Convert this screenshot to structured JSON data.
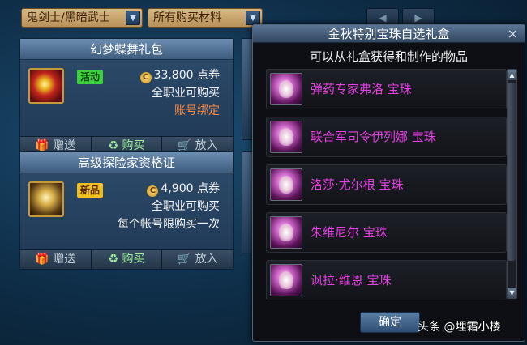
{
  "filters": {
    "class_label": "鬼剑士/黑暗武士",
    "material_label": "所有购买材料"
  },
  "cards": [
    {
      "title": "幻梦蝶舞礼包",
      "badge": "活动",
      "price_value": "33,800",
      "price_unit": "点券",
      "line1": "全职业可购买",
      "line2": "账号绑定",
      "gift": "赠送",
      "buy": "购买",
      "cart": "放入"
    },
    {
      "title": "高级探险家资格证",
      "badge": "新品",
      "price_value": "4,900",
      "price_unit": "点券",
      "line1": "全职业可购买",
      "line2": "每个帐号限购买一次",
      "gift": "赠送",
      "buy": "购买",
      "cart": "放入"
    }
  ],
  "dialog": {
    "title": "金秋特别宝珠自选礼盒",
    "close": "×",
    "subtitle": "可以从礼盒获得和制作的物品",
    "items": [
      {
        "name": "弹药专家弗洛 宝珠"
      },
      {
        "name": "联合军司令伊列娜 宝珠"
      },
      {
        "name": "洛莎·尤尔根 宝珠"
      },
      {
        "name": "朱维尼尔 宝珠"
      },
      {
        "name": "讽拉·维恩 宝珠"
      }
    ],
    "confirm": "确定"
  },
  "watermark": "头条 @埋霜小楼",
  "colors": {
    "item_text": "#e540e2",
    "bound_text": "#ff8a3d",
    "activity_badge": "#3bd23b",
    "new_badge": "#f0c020"
  }
}
